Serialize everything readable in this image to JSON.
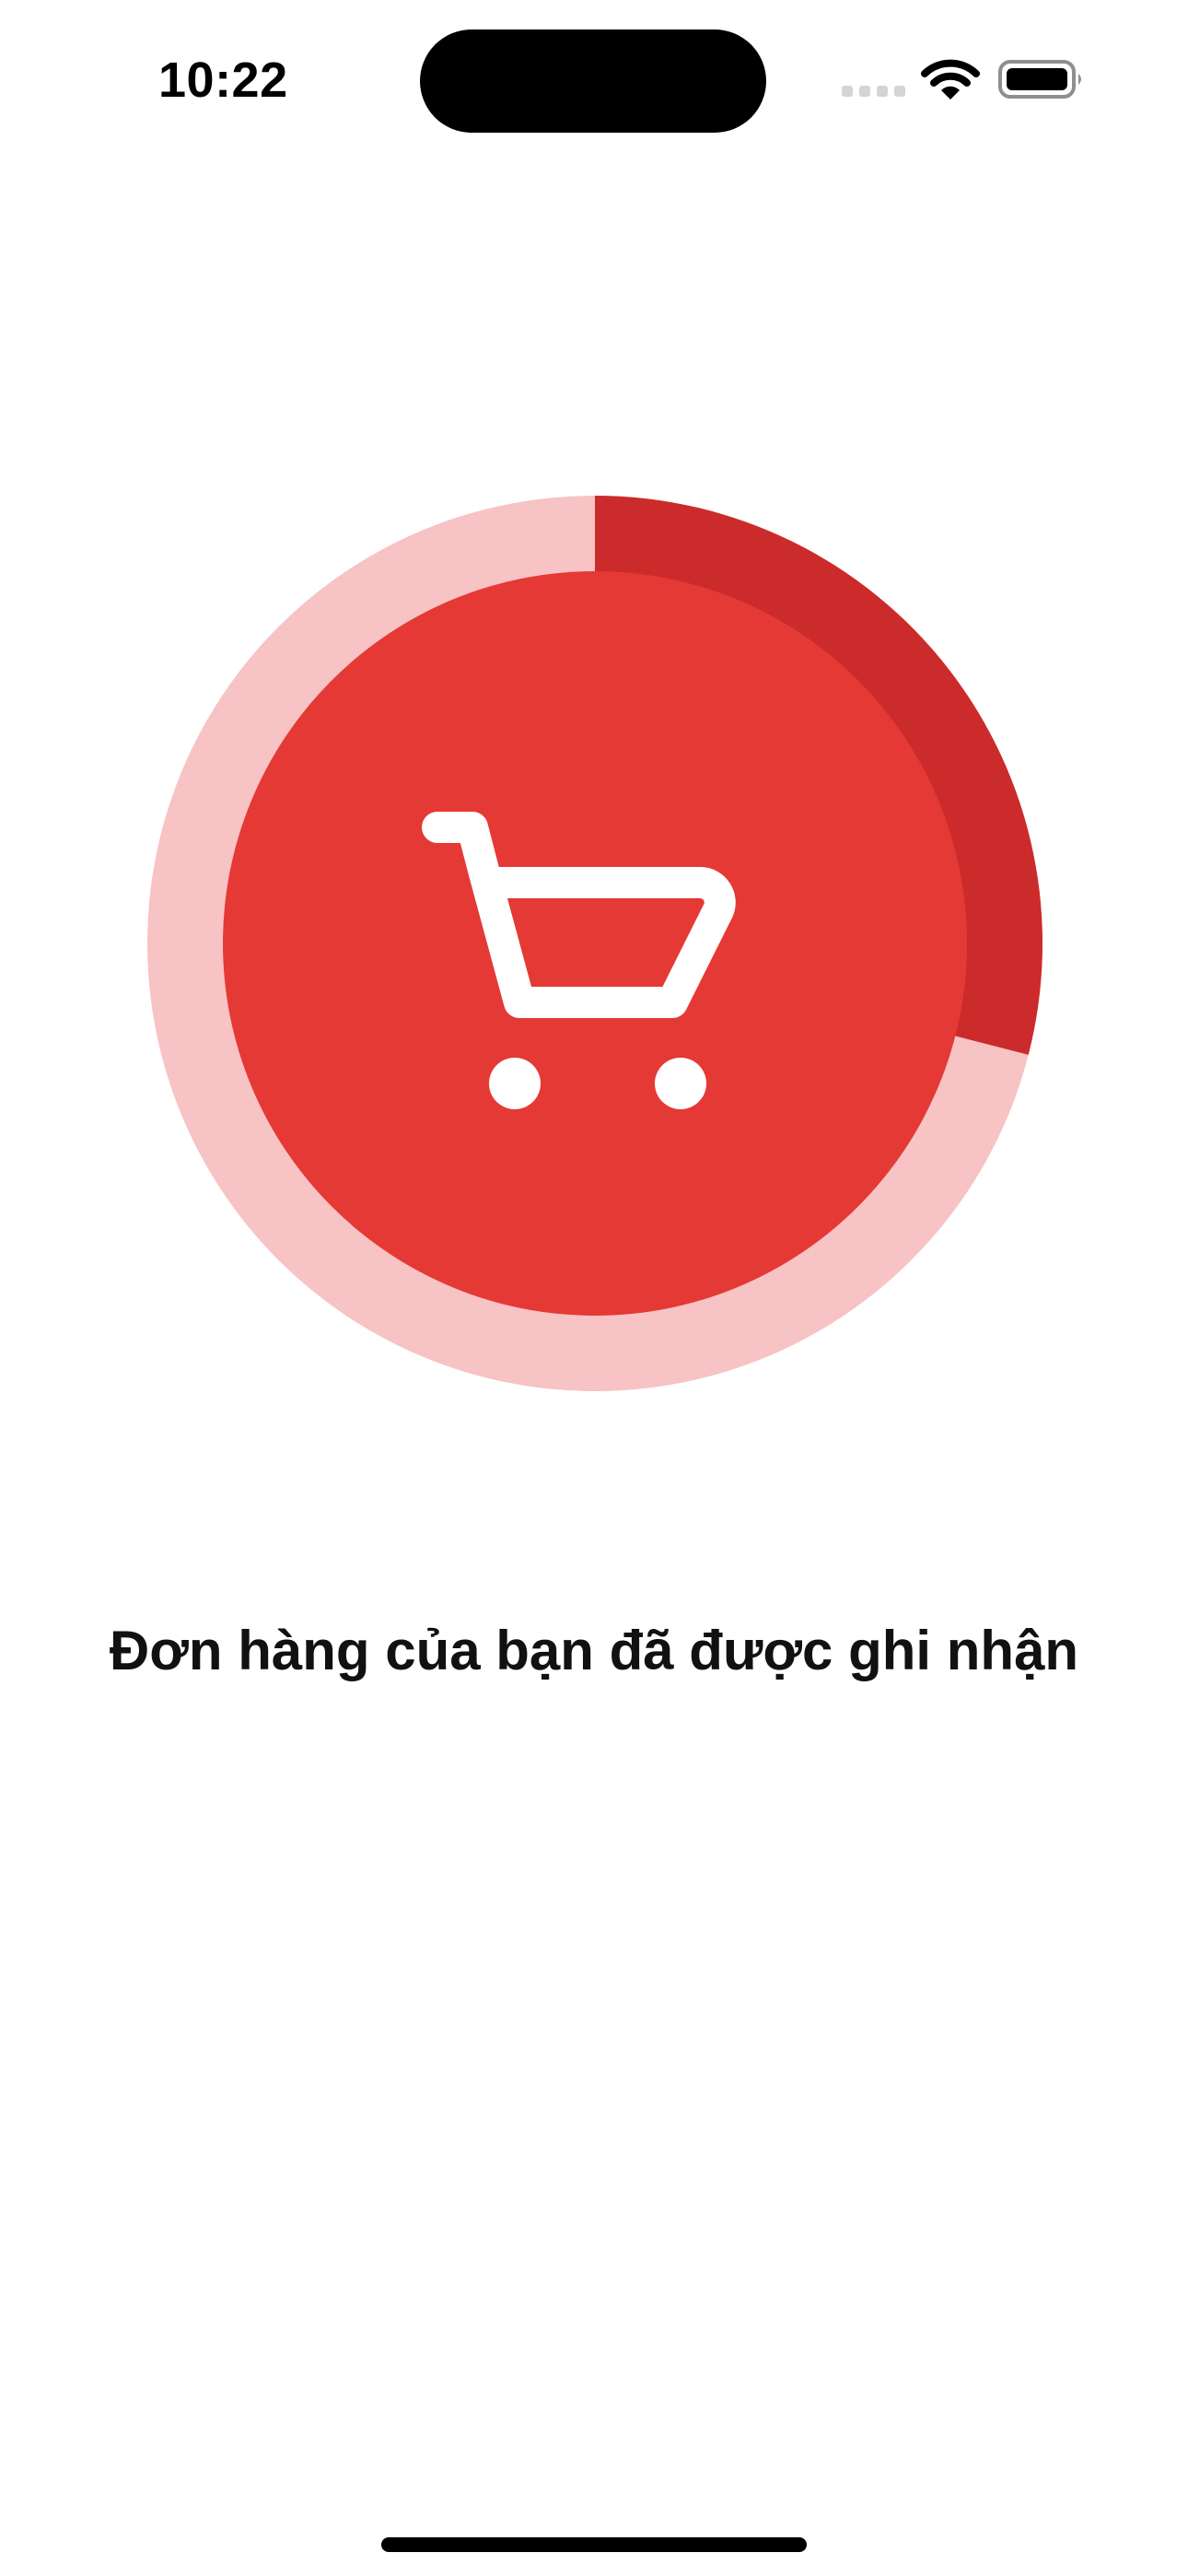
{
  "status_bar": {
    "time": "10:22",
    "icons": [
      "cellular-signal-icon",
      "wifi-icon",
      "battery-icon"
    ]
  },
  "order_progress": {
    "progress_fraction": 0.29,
    "icon": "shopping-cart-icon",
    "colors": {
      "track": "#f7c3c4",
      "progress": "#cc2b2b",
      "center": "#e53935",
      "icon": "#ffffff"
    }
  },
  "message": {
    "text": "Đơn hàng của bạn đã được ghi nhận"
  }
}
